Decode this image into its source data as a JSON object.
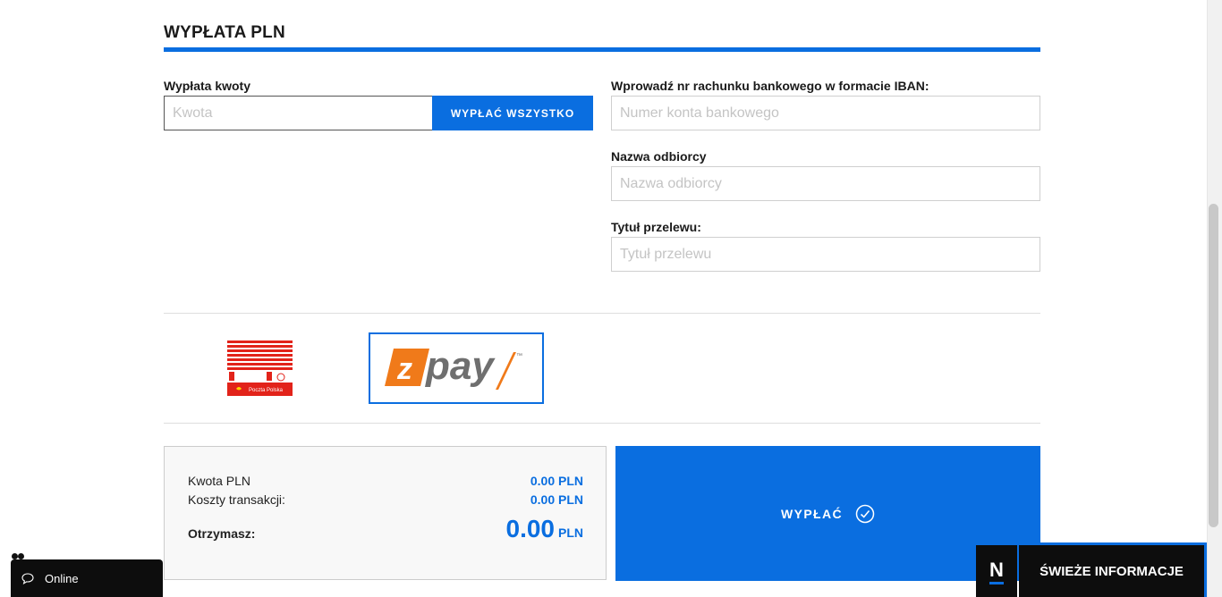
{
  "section": {
    "title": "WYPŁATA PLN"
  },
  "amount": {
    "label": "Wypłata kwoty",
    "placeholder": "Kwota",
    "withdraw_all_label": "WYPŁAĆ WSZYSTKO"
  },
  "iban": {
    "label": "Wprowadź nr rachunku bankowego w formacie IBAN:",
    "placeholder": "Numer konta bankowego"
  },
  "recipient": {
    "label": "Nazwa odbiorcy",
    "placeholder": "Nazwa odbiorcy"
  },
  "transfer_title": {
    "label": "Tytuł przelewu:",
    "placeholder": "Tytuł przelewu"
  },
  "payment_methods": [
    {
      "name": "Poczta Polska",
      "logo_text": "Poczta Polska",
      "selected": false
    },
    {
      "name": "zpay",
      "logo_text": "pay",
      "logo_badge": "z",
      "trademark": "™",
      "selected": true
    }
  ],
  "summary": {
    "amount_label": "Kwota PLN",
    "amount_value": "0.00 PLN",
    "fee_label": "Koszty transakcji:",
    "fee_value": "0.00 PLN",
    "receive_label": "Otrzymasz:",
    "receive_value": "0.00",
    "receive_currency": "PLN"
  },
  "submit": {
    "label": "WYPŁAĆ",
    "icon": "check-circle-icon"
  },
  "chat": {
    "status": "Online",
    "icon": "chat-bubble-icon"
  },
  "news": {
    "logo_letter": "N",
    "label": "ŚWIEŻE INFORMACJE"
  },
  "colors": {
    "accent": "#0a6ee0",
    "zpay_orange": "#f07a1a",
    "zpay_gray": "#6f6f6f",
    "poczta_red": "#e2231a"
  }
}
